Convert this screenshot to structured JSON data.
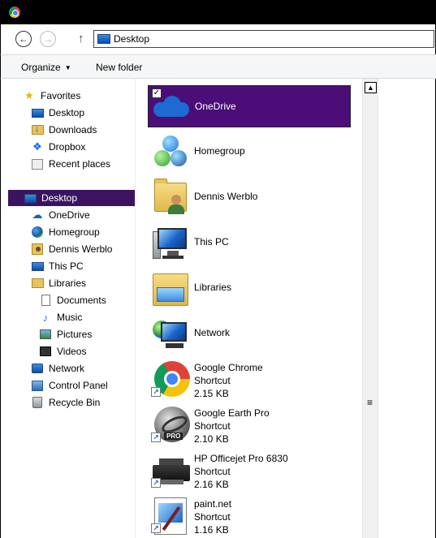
{
  "window": {
    "app_icon": "chrome-logo-icon"
  },
  "address": {
    "path": "Desktop",
    "icon": "this-pc-icon"
  },
  "toolbar": {
    "organize_label": "Organize",
    "new_folder_label": "New folder"
  },
  "nav": {
    "items": [
      {
        "label": "Favorites",
        "icon": "star-icon"
      },
      {
        "label": "Desktop",
        "icon": "monitor-icon"
      },
      {
        "label": "Downloads",
        "icon": "downloads-folder-icon"
      },
      {
        "label": "Dropbox",
        "icon": "dropbox-icon"
      },
      {
        "label": "Recent places",
        "icon": "recent-places-icon"
      },
      {
        "label": "Desktop",
        "icon": "monitor-icon",
        "selected": true
      },
      {
        "label": "OneDrive",
        "icon": "cloud-icon"
      },
      {
        "label": "Homegroup",
        "icon": "homegroup-icon"
      },
      {
        "label": "Dennis Werblo",
        "icon": "user-folder-icon"
      },
      {
        "label": "This PC",
        "icon": "this-pc-icon"
      },
      {
        "label": "Libraries",
        "icon": "libraries-icon"
      },
      {
        "label": "Documents",
        "icon": "document-icon"
      },
      {
        "label": "Music",
        "icon": "music-note-icon"
      },
      {
        "label": "Pictures",
        "icon": "pictures-icon"
      },
      {
        "label": "Videos",
        "icon": "videos-icon"
      },
      {
        "label": "Network",
        "icon": "network-icon"
      },
      {
        "label": "Control Panel",
        "icon": "control-panel-icon"
      },
      {
        "label": "Recycle Bin",
        "icon": "recycle-bin-icon"
      }
    ]
  },
  "files": [
    {
      "name": "OneDrive",
      "icon": "onedrive-cloud-icon",
      "selected": true,
      "checked": true
    },
    {
      "name": "Homegroup",
      "icon": "homegroup-icon"
    },
    {
      "name": "Dennis Werblo",
      "icon": "user-folder-icon"
    },
    {
      "name": "This PC",
      "icon": "this-pc-icon"
    },
    {
      "name": "Libraries",
      "icon": "libraries-icon"
    },
    {
      "name": "Network",
      "icon": "network-icon"
    },
    {
      "name": "Google Chrome",
      "type": "Shortcut",
      "size": "2.15 KB",
      "icon": "google-chrome-icon"
    },
    {
      "name": "Google Earth Pro",
      "type": "Shortcut",
      "size": "2.10 KB",
      "icon": "google-earth-pro-icon",
      "badge": "PRO"
    },
    {
      "name": "HP Officejet Pro 6830",
      "type": "Shortcut",
      "size": "2.16 KB",
      "icon": "printer-icon"
    },
    {
      "name": "paint.net",
      "type": "Shortcut",
      "size": "1.16 KB",
      "icon": "paint-net-icon"
    }
  ],
  "checkbox_mark": "✓",
  "scroll_up_glyph": "▲",
  "scroll_grip_glyph": "≡",
  "colors": {
    "selection": "#3c1361",
    "file_selection": "#4b0e78",
    "titlebar": "#000000"
  }
}
